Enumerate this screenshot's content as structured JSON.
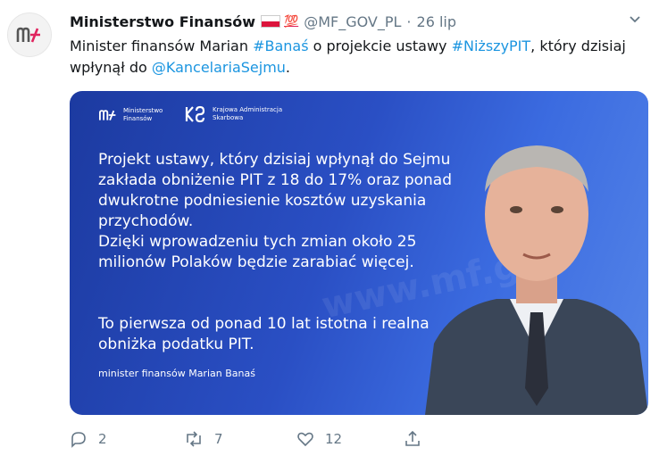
{
  "tweet": {
    "author_name": "Ministerstwo Finansów",
    "emoji_hundred": "💯",
    "handle": "@MF_GOV_PL",
    "dot": "·",
    "date": "26 lip",
    "text": {
      "t1": "Minister finansów Marian ",
      "h1": "#Banaś",
      "t2": " o projekcie ustawy ",
      "h2": "#NiższyPIT",
      "t3": ", który dzisiaj wpłynął do ",
      "m1": "@KancelariaSejmu",
      "t4": "."
    }
  },
  "card": {
    "logo1_line1": "Ministerstwo",
    "logo1_line2": "Finansów",
    "logo2_line1": "Krajowa Administracja",
    "logo2_line2": "Skarbowa",
    "paragraph1": "Projekt ustawy, który dzisiaj wpłynął do Sejmu zakłada obniżenie PIT z 18 do 17% oraz ponad dwukrotne podniesienie kosztów uzyskania przychodów.",
    "paragraph2": "Dzięki wprowadzeniu tych zmian około 25 milionów Polaków będzie zarabiać więcej.",
    "paragraph3": "To pierwsza od ponad 10 lat istotna i realna obniżka podatku PIT.",
    "signature": "minister finansów Marian Banaś",
    "bg_watermark": "www.mf.gov"
  },
  "actions": {
    "reply_count": "2",
    "retweet_count": "7",
    "like_count": "12"
  }
}
